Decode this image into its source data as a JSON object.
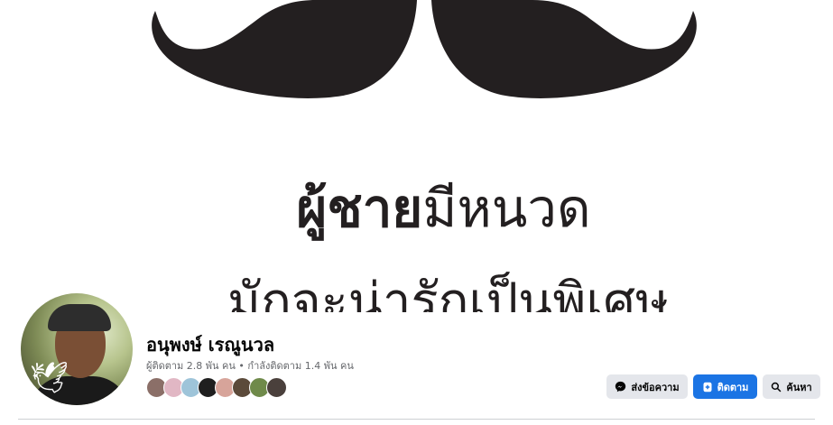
{
  "cover": {
    "line1_bold": "ผู้ชาย",
    "line1_regular": "มีหนวด",
    "line2": "มักจะน่ารักเป็นพิเศษ"
  },
  "profile": {
    "name": "อนุพงษ์ เรณูนวล",
    "stats": "ผู้ติดตาม 2.8 พัน คน • กำลังติดตาม 1.4 พัน คน"
  },
  "friends_count_visible": 8,
  "actions": {
    "message_label": "ส่งข้อความ",
    "follow_label": "ติดตาม",
    "search_label": "ค้นหา"
  },
  "icons": {
    "message": "messenger-icon",
    "follow": "follow-icon",
    "search": "search-icon"
  },
  "colors": {
    "accent": "#1b74e4",
    "button_gray": "#e4e6eb",
    "secondary_text": "#65676b"
  }
}
